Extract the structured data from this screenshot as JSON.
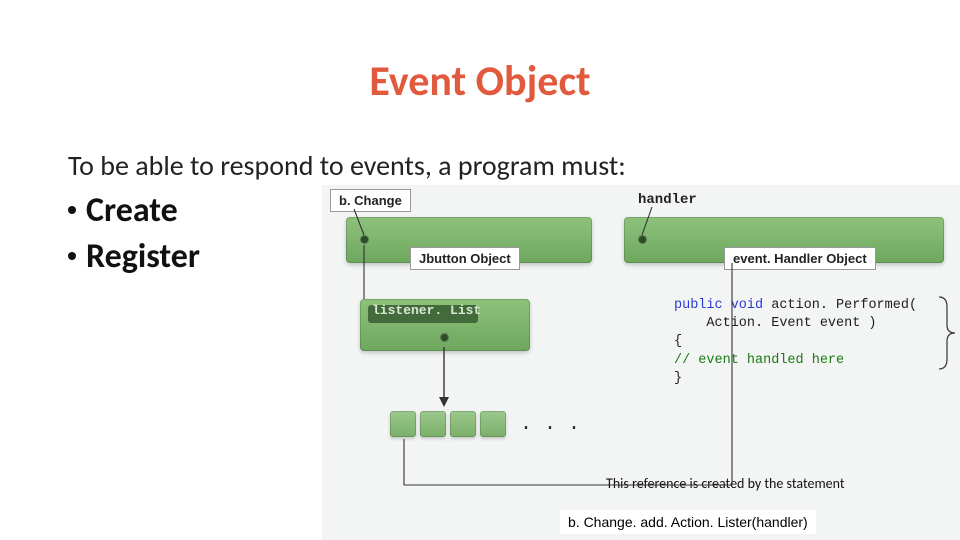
{
  "title": "Event Object",
  "intro": "To be able to respond to events, a program must:",
  "bullets": [
    "Create",
    "Register"
  ],
  "diagram": {
    "bChange_label": "b. Change",
    "jbutton_label": "Jbutton Object",
    "handler_label": "handler",
    "eventHandler_label": "event. Handler Object",
    "listenerList_label": "listener. List",
    "code_sig_kw": "public void",
    "code_sig_name": " action. Performed(",
    "code_arg": "    Action. Event event )",
    "code_open": "{",
    "code_comment": "// event handled here",
    "code_close": "}",
    "ellipsis": ". . .",
    "ref_text": "This reference is created by the statement"
  },
  "footer": "b. Change. add. Action. Lister(handler)"
}
